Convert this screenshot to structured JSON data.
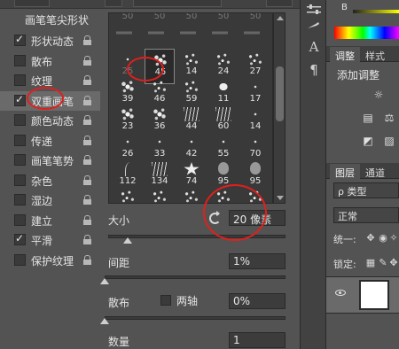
{
  "top_strip": {
    "right_label": "翻转"
  },
  "brush_panel": {
    "header": "画笔笔尖形状",
    "items": [
      {
        "label": "形状动态",
        "checked": true,
        "lock": true
      },
      {
        "label": "散布",
        "checked": false,
        "lock": true
      },
      {
        "label": "纹理",
        "checked": false,
        "lock": true
      },
      {
        "label": "双重画笔",
        "checked": true,
        "lock": true,
        "selected": true
      },
      {
        "label": "颜色动态",
        "checked": false,
        "lock": true
      },
      {
        "label": "传递",
        "checked": false,
        "lock": true
      },
      {
        "label": "画笔笔势",
        "checked": false,
        "lock": true
      },
      {
        "label": "杂色",
        "checked": false,
        "lock": true
      },
      {
        "label": "湿边",
        "checked": false,
        "lock": true
      },
      {
        "label": "建立",
        "checked": false,
        "lock": true
      },
      {
        "label": "平滑",
        "checked": true,
        "lock": true
      },
      {
        "label": "保护纹理",
        "checked": false,
        "lock": true
      }
    ]
  },
  "presets": {
    "rows": [
      [
        {
          "n": "50",
          "s": "dim"
        },
        {
          "n": "50",
          "s": "dim"
        },
        {
          "n": "50",
          "s": "dim"
        },
        {
          "n": "50",
          "s": "dim"
        },
        {
          "n": "50",
          "s": "dim"
        }
      ],
      [
        {
          "n": "",
          "s": "arrow"
        },
        {
          "n": "",
          "s": "arrow"
        },
        {
          "n": "",
          "s": "arrow"
        },
        {
          "n": "",
          "s": "arrow"
        },
        {
          "n": "",
          "s": "arrow"
        }
      ],
      [
        {
          "n": "25",
          "s": "dim"
        },
        {
          "n": "45",
          "s": "splat",
          "selected": true
        },
        {
          "n": "14",
          "s": "scatter"
        },
        {
          "n": "24",
          "s": "scatter"
        },
        {
          "n": "27",
          "s": "scatter"
        }
      ],
      [
        {
          "n": "39",
          "s": "splat"
        },
        {
          "n": "46",
          "s": "scatter"
        },
        {
          "n": "59",
          "s": "scatter"
        },
        {
          "n": "11",
          "s": "leaf"
        },
        {
          "n": "17",
          "s": "dot"
        }
      ],
      [
        {
          "n": "23",
          "s": "splat"
        },
        {
          "n": "36",
          "s": "splat"
        },
        {
          "n": "44",
          "s": "grass"
        },
        {
          "n": "60",
          "s": "grass"
        },
        {
          "n": "14",
          "s": "dot"
        }
      ],
      [
        {
          "n": "26",
          "s": "dot"
        },
        {
          "n": "33",
          "s": "dot"
        },
        {
          "n": "42",
          "s": "dot"
        },
        {
          "n": "55",
          "s": "dot"
        },
        {
          "n": "70",
          "s": "dot"
        }
      ],
      [
        {
          "n": "112",
          "s": "curve"
        },
        {
          "n": "134",
          "s": "grass"
        },
        {
          "n": "74",
          "s": "star"
        },
        {
          "n": "95",
          "s": "drop"
        },
        {
          "n": "95",
          "s": "drop"
        }
      ],
      [
        {
          "n": "",
          "s": "scatter"
        },
        {
          "n": "",
          "s": "scatter"
        },
        {
          "n": "",
          "s": "scatter"
        },
        {
          "n": "",
          "s": "scatter"
        },
        {
          "n": "",
          "s": "scatter"
        }
      ]
    ]
  },
  "controls": {
    "size_label": "大小",
    "size_value": "20 像素",
    "size_slider_fraction": 0.11,
    "spacing_label": "间距",
    "spacing_value": "1%",
    "spacing_slider_fraction": 0.0,
    "scatter_label": "散布",
    "both_axes_label": "两轴",
    "scatter_value": "0%",
    "scatter_slider_fraction": 0.0,
    "count_label": "数量",
    "count_value": "1"
  },
  "tool_strip": {
    "icons": [
      "sliders-icon",
      "brush-icon",
      "type-icon",
      "paragraph-icon"
    ]
  },
  "right_dock": {
    "color": {
      "channel_label": "B"
    },
    "tabs_adjust": [
      "调整",
      "样式"
    ],
    "adjust_title": "添加调整",
    "tabs_layers": [
      "图层",
      "通道"
    ],
    "filter_label": "ρ 类型",
    "blend_mode": "正常",
    "unify_label": "统一:",
    "lock_label": "锁定:"
  },
  "colors": {
    "annotation": "#e0201c",
    "panel": "#535353",
    "field": "#3c3c3c"
  }
}
